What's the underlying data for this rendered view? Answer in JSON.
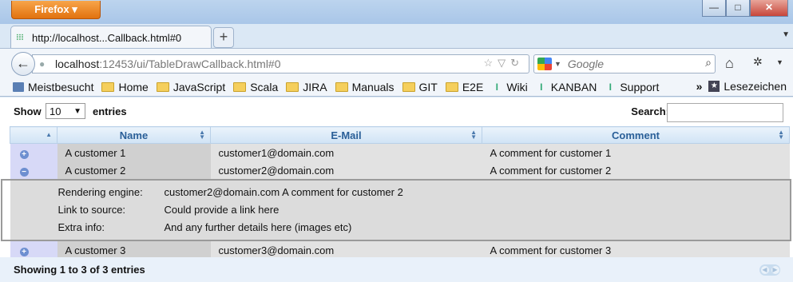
{
  "window": {
    "app_button": "Firefox ▾",
    "minimize": "—",
    "maximize": "□",
    "close": "✕"
  },
  "tab": {
    "title": "http://localhost...Callback.html#0",
    "new_tab": "+"
  },
  "nav": {
    "url_host": "localhost",
    "url_path": ":12453/ui/TableDrawCallback.html#0",
    "search_placeholder": "Google"
  },
  "bookmarks": {
    "items": [
      {
        "label": "Meistbesucht",
        "icon": "page-icon"
      },
      {
        "label": "Home",
        "icon": "folder-icon"
      },
      {
        "label": "JavaScript",
        "icon": "folder-icon"
      },
      {
        "label": "Scala",
        "icon": "folder-icon"
      },
      {
        "label": "JIRA",
        "icon": "folder-icon"
      },
      {
        "label": "Manuals",
        "icon": "folder-icon"
      },
      {
        "label": "GIT",
        "icon": "folder-icon"
      },
      {
        "label": "E2E",
        "icon": "folder-icon"
      },
      {
        "label": "Wiki",
        "icon": "jira-icon"
      },
      {
        "label": "KANBAN",
        "icon": "jira-icon"
      },
      {
        "label": "Support",
        "icon": "jira-icon"
      }
    ],
    "overflow": "»",
    "lesezeichen": "Lesezeichen"
  },
  "table": {
    "show_label": "Show",
    "length_value": "10",
    "entries_label": "entries",
    "search_label": "Search:",
    "columns": [
      "Name",
      "E-Mail",
      "Comment"
    ],
    "rows": [
      {
        "toggle": "+",
        "name": "A customer 1",
        "email": "customer1@domain.com",
        "comment": "A comment for customer 1"
      },
      {
        "toggle": "−",
        "name": "A customer 2",
        "email": "customer2@domain.com",
        "comment": "A comment for customer 2"
      },
      {
        "toggle": "+",
        "name": "A customer 3",
        "email": "customer3@domain.com",
        "comment": "A comment for customer 3"
      }
    ],
    "details": [
      {
        "label": "Rendering engine:",
        "value": "customer2@domain.com A comment for customer 2"
      },
      {
        "label": "Link to source:",
        "value": "Could provide a link here"
      },
      {
        "label": "Extra info:",
        "value": "And any further details here (images etc)"
      }
    ],
    "info": "Showing 1 to 3 of 3 entries"
  }
}
